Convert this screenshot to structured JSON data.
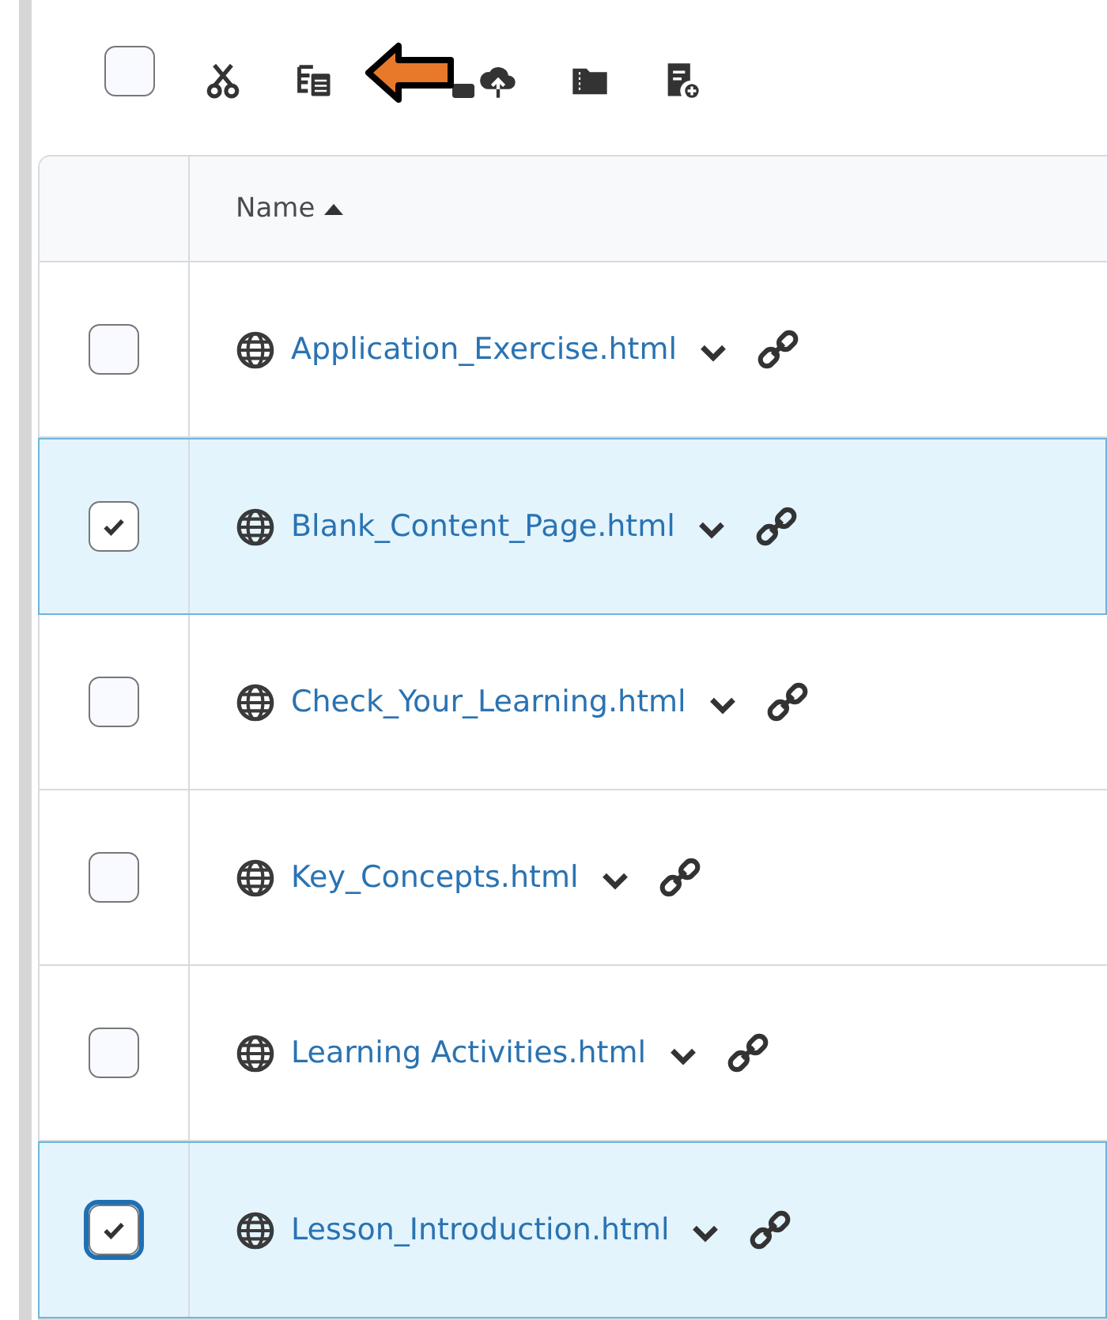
{
  "toolbar": {
    "select_all_checked": false
  },
  "table": {
    "columns": [
      {
        "label": "Name",
        "sorted_ascending": true
      }
    ],
    "rows": [
      {
        "name": "Application_Exercise.html",
        "selected": false,
        "focused": false
      },
      {
        "name": "Blank_Content_Page.html",
        "selected": true,
        "focused": false
      },
      {
        "name": "Check_Your_Learning.html",
        "selected": false,
        "focused": false
      },
      {
        "name": "Key_Concepts.html",
        "selected": false,
        "focused": false
      },
      {
        "name": "Learning Activities.html",
        "selected": false,
        "focused": false
      },
      {
        "name": "Lesson_Introduction.html",
        "selected": true,
        "focused": true
      }
    ]
  }
}
